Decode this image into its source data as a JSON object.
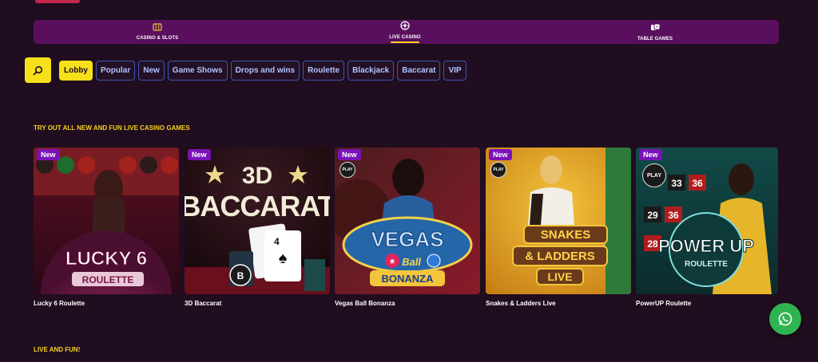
{
  "nav": {
    "tabs": [
      {
        "label": "CASINO & SLOTS",
        "icon": "slot-machine-icon"
      },
      {
        "label": "LIVE CASINO",
        "icon": "roulette-wheel-icon",
        "active": true
      },
      {
        "label": "TABLE GAMES",
        "icon": "dice-icon"
      }
    ]
  },
  "filters": {
    "search_icon": "search-icon",
    "chips": [
      "Lobby",
      "Popular",
      "New",
      "Game Shows",
      "Drops and wins",
      "Roulette",
      "Blackjack",
      "Baccarat",
      "VIP"
    ],
    "active": "Lobby"
  },
  "sections": {
    "new_games": "TRY OUT ALL NEW AND FUN LIVE CASINO GAMES",
    "live_fun": "LIVE AND FUN!"
  },
  "games": [
    {
      "name": "Lucky 6 Roulette",
      "badge": "New",
      "logo_line1": "LUCKY 6",
      "logo_line2": "ROULETTE",
      "accent": "#a81d4a"
    },
    {
      "name": "3D Baccarat",
      "badge": "New",
      "logo_line1": "3D",
      "logo_line2": "BACCARAT",
      "accent": "#3a2a33"
    },
    {
      "name": "Vegas Ball Bonanza",
      "badge": "New",
      "play": "PLAY",
      "logo_line1": "VEGAS Ball",
      "logo_line2": "BONANZA",
      "accent": "#2466a8"
    },
    {
      "name": "Snakes & Ladders Live",
      "badge": "New",
      "play": "PLAY",
      "logo_line1": "SNAKES & LADDERS",
      "logo_line2": "LIVE",
      "accent": "#c98a1d"
    },
    {
      "name": "PowerUP Roulette",
      "badge": "New",
      "play": "PLAY",
      "logo_line1": "POWER UP",
      "logo_line2": "ROULETTE",
      "accent": "#16584a"
    }
  ],
  "colors": {
    "accent_yellow": "#f6e01a",
    "nav_bg": "#5a0f5e",
    "page_bg": "#200d1f",
    "whatsapp": "#2fb452"
  }
}
